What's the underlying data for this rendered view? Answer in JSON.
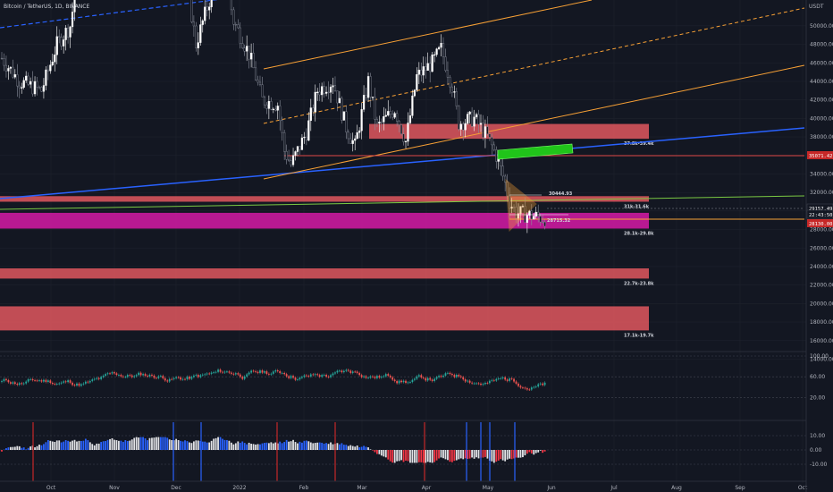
{
  "header": {
    "title": "Bitcoin / TetherUS, 1D, BINANCE",
    "currency": "USDT"
  },
  "chart_data": {
    "type": "candlestick",
    "symbol": "Bitcoin / TetherUS",
    "interval": "1D",
    "exchange": "BINANCE",
    "price_axis": {
      "unit": "USDT",
      "range": [
        12000,
        52000
      ],
      "ticks": [
        "50000.00",
        "48000.00",
        "46000.00",
        "44000.00",
        "42000.00",
        "40000.00",
        "38000.00",
        "36000.00",
        "34000.00",
        "32000.00",
        "30000.00",
        "28000.00",
        "26000.00",
        "24000.00",
        "22000.00",
        "20000.00",
        "18000.00",
        "16000.00",
        "14000.00"
      ]
    },
    "time_axis": {
      "labels": [
        "Oct",
        "Nov",
        "Dec",
        "2022",
        "Feb",
        "Mar",
        "Apr",
        "May",
        "Jun",
        "Jul",
        "Aug",
        "Sep",
        "Oct"
      ]
    },
    "price_labels": [
      {
        "text": "35071.42",
        "value": 35071.42,
        "color": "#c62828"
      },
      {
        "text": "29157.49",
        "value": 29157.49,
        "color": "#131722"
      },
      {
        "text": "22:43:50",
        "value": 28500,
        "color": "#131722"
      },
      {
        "text": "28130.00",
        "value": 28130,
        "color": "#c62828"
      }
    ],
    "zones": [
      {
        "label": "37.8k-39.4k",
        "low": 37800,
        "high": 39400
      },
      {
        "label": "31k-31.6k",
        "low": 31000,
        "high": 31600
      },
      {
        "label": "28.1k-29.8k",
        "low": 28100,
        "high": 29800
      },
      {
        "label": "22.7k-23.8k",
        "low": 22700,
        "high": 23800
      },
      {
        "label": "17.1k-19.7k",
        "low": 17100,
        "high": 19700
      }
    ],
    "annotations": [
      {
        "text": "30444.93",
        "value": 30444.93
      },
      {
        "text": "28715.32",
        "value": 28715.32
      }
    ],
    "rsi": {
      "ticks": [
        "100.00",
        "60.00",
        "20.00"
      ],
      "levels": [
        100,
        60,
        20
      ]
    },
    "macd": {
      "ticks": [
        "10.00",
        "0.00",
        "-10.00"
      ],
      "levels": [
        10,
        0,
        -10
      ]
    }
  },
  "colors": {
    "background": "#131722",
    "grid": "#1e222d",
    "up": "#ffffff",
    "down": "#363a45",
    "zone": "#e0575e",
    "magenta_zone": "#d61aa6",
    "blue_trend": "#2962ff",
    "orange_channel": "#f7a035",
    "green_box": "#20c41a",
    "rsi_green": "#26a69a",
    "rsi_red": "#ef5350"
  }
}
